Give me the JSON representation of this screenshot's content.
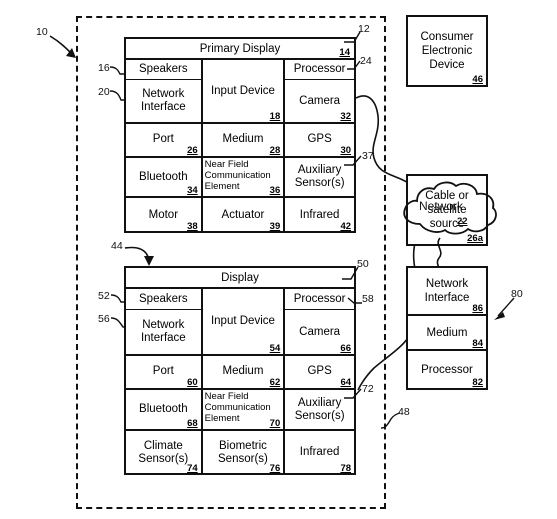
{
  "figure": {
    "title": "Patent figure: primary display device and secondary display device connected via network",
    "outer_ref": "10",
    "system_ref": "48"
  },
  "primary_device": {
    "ref_pointer": "12",
    "header": {
      "label": "Primary Display",
      "ref": "14"
    },
    "left_labels": [
      {
        "ref": "16",
        "target": "Speakers"
      },
      {
        "ref": "20",
        "target": "Network Interface"
      }
    ],
    "right_labels": [
      {
        "ref": "24",
        "target": "Processor"
      },
      {
        "ref": "37",
        "target": "Auxiliary Sensor(s)"
      }
    ],
    "cells": [
      {
        "label": "Speakers",
        "ref": ""
      },
      {
        "label": "Input Device",
        "ref": "18"
      },
      {
        "label": "Processor",
        "ref": ""
      },
      {
        "label": "Network Interface",
        "ref": ""
      },
      {
        "label": "Camera",
        "ref": "32"
      },
      {
        "label": "Port",
        "ref": "26"
      },
      {
        "label": "Medium",
        "ref": "28"
      },
      {
        "label": "GPS",
        "ref": "30"
      },
      {
        "label": "Bluetooth",
        "ref": "34"
      },
      {
        "label": "Near Field Communication Element",
        "ref": "36"
      },
      {
        "label": "Auxiliary Sensor(s)",
        "ref": ""
      },
      {
        "label": "Motor",
        "ref": "38"
      },
      {
        "label": "Actuator",
        "ref": "39"
      },
      {
        "label": "Infrared",
        "ref": "42"
      }
    ]
  },
  "secondary_device": {
    "ref_pointer_arrow": "44",
    "ref_pointer": "50",
    "header": {
      "label": "Display",
      "ref": ""
    },
    "left_labels": [
      {
        "ref": "52",
        "target": "Speakers"
      },
      {
        "ref": "56",
        "target": "Network Interface"
      }
    ],
    "right_labels": [
      {
        "ref": "58",
        "target": "Processor"
      },
      {
        "ref": "72",
        "target": "Auxiliary Sensor(s)"
      }
    ],
    "cells": [
      {
        "label": "Speakers",
        "ref": ""
      },
      {
        "label": "Input Device",
        "ref": "54"
      },
      {
        "label": "Processor",
        "ref": ""
      },
      {
        "label": "Network Interface",
        "ref": ""
      },
      {
        "label": "Camera",
        "ref": "66"
      },
      {
        "label": "Port",
        "ref": "60"
      },
      {
        "label": "Medium",
        "ref": "62"
      },
      {
        "label": "GPS",
        "ref": "64"
      },
      {
        "label": "Bluetooth",
        "ref": "68"
      },
      {
        "label": "Near Field Communication Element",
        "ref": "70"
      },
      {
        "label": "Auxiliary Sensor(s)",
        "ref": ""
      },
      {
        "label": "Climate Sensor(s)",
        "ref": "74"
      },
      {
        "label": "Biometric Sensor(s)",
        "ref": "76"
      },
      {
        "label": "Infrared",
        "ref": "78"
      }
    ]
  },
  "right_column": {
    "consumer_device": {
      "label": "Consumer Electronic Device",
      "ref": "46"
    },
    "cable_source": {
      "label": "Cable or satellite source",
      "ref": "26a"
    },
    "network_cloud": {
      "label": "Network",
      "ref": "22"
    },
    "server": {
      "ref": "80",
      "rows": [
        {
          "label": "Network Interface",
          "ref": "86"
        },
        {
          "label": "Medium",
          "ref": "84"
        },
        {
          "label": "Processor",
          "ref": "82"
        }
      ]
    }
  },
  "colors": {
    "ink": "#111111",
    "paper": "#ffffff"
  }
}
